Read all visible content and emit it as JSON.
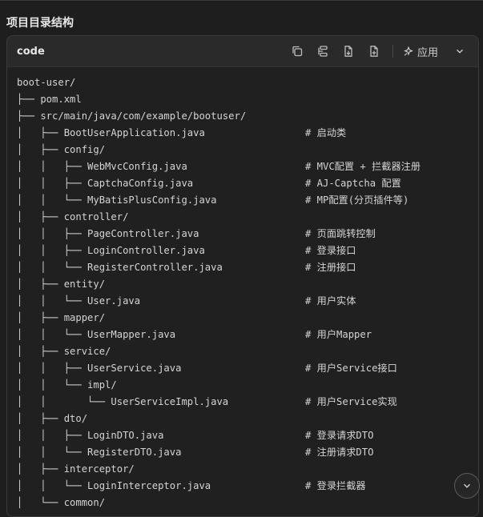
{
  "section_heading": "项目目录结构",
  "code_block": {
    "language": "code",
    "apply_label": "应用",
    "icons": [
      "copy-icon",
      "format-icon",
      "insert-file-icon",
      "new-file-icon",
      "sparkle-icon",
      "chevron-down-icon"
    ],
    "lines": [
      {
        "code": "boot-user/",
        "comment": ""
      },
      {
        "code": "├── pom.xml",
        "comment": ""
      },
      {
        "code": "├── src/main/java/com/example/bootuser/",
        "comment": ""
      },
      {
        "code": "│   ├── BootUserApplication.java",
        "comment": "# 启动类"
      },
      {
        "code": "│   ├── config/",
        "comment": ""
      },
      {
        "code": "│   │   ├── WebMvcConfig.java",
        "comment": "# MVC配置 + 拦截器注册"
      },
      {
        "code": "│   │   ├── CaptchaConfig.java",
        "comment": "# AJ-Captcha 配置"
      },
      {
        "code": "│   │   └── MyBatisPlusConfig.java",
        "comment": "# MP配置(分页插件等)"
      },
      {
        "code": "│   ├── controller/",
        "comment": ""
      },
      {
        "code": "│   │   ├── PageController.java",
        "comment": "# 页面跳转控制"
      },
      {
        "code": "│   │   ├── LoginController.java",
        "comment": "# 登录接口"
      },
      {
        "code": "│   │   └── RegisterController.java",
        "comment": "# 注册接口"
      },
      {
        "code": "│   ├── entity/",
        "comment": ""
      },
      {
        "code": "│   │   └── User.java",
        "comment": "# 用户实体"
      },
      {
        "code": "│   ├── mapper/",
        "comment": ""
      },
      {
        "code": "│   │   └── UserMapper.java",
        "comment": "# 用户Mapper"
      },
      {
        "code": "│   ├── service/",
        "comment": ""
      },
      {
        "code": "│   │   ├── UserService.java",
        "comment": "# 用户Service接口"
      },
      {
        "code": "│   │   └── impl/",
        "comment": ""
      },
      {
        "code": "│   │       └── UserServiceImpl.java",
        "comment": "# 用户Service实现"
      },
      {
        "code": "│   ├── dto/",
        "comment": ""
      },
      {
        "code": "│   │   ├── LoginDTO.java",
        "comment": "# 登录请求DTO"
      },
      {
        "code": "│   │   └── RegisterDTO.java",
        "comment": "# 注册请求DTO"
      },
      {
        "code": "│   ├── interceptor/",
        "comment": ""
      },
      {
        "code": "│   │   └── LoginInterceptor.java",
        "comment": "# 登录拦截器"
      },
      {
        "code": "│   └── common/",
        "comment": ""
      }
    ]
  },
  "scroll_down_icon": "chevron-down-icon"
}
